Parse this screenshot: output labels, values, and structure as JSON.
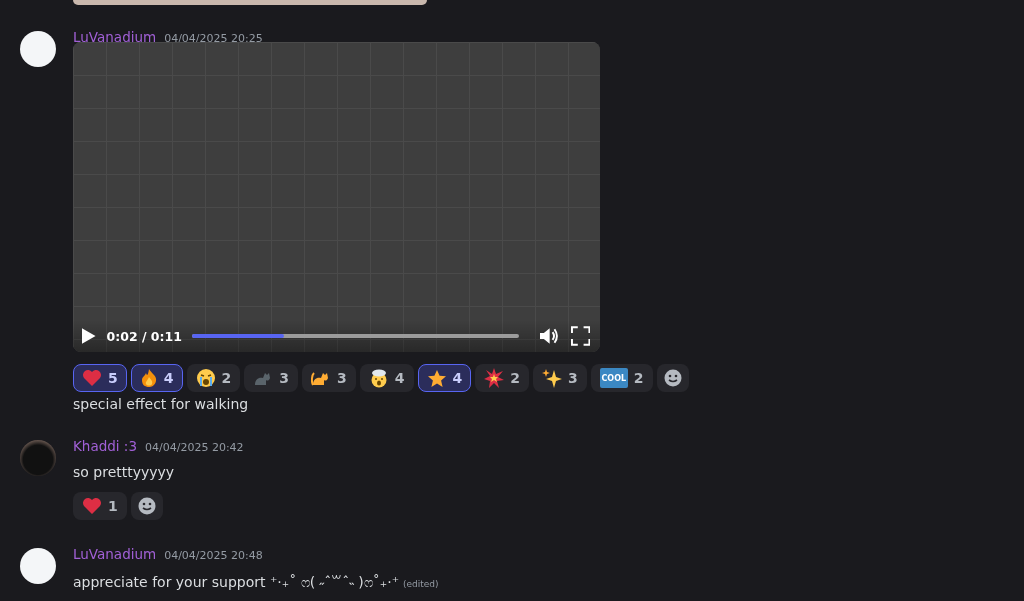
{
  "messages": [
    {
      "author": "LuVanadium",
      "timestamp": "04/04/2025 20:25",
      "avatar": {
        "kind": "sketch"
      },
      "video": {
        "current": "0:02 / 0:11",
        "level": 0.28
      },
      "reactions": [
        {
          "kind": "heart",
          "count": "5",
          "selected": true
        },
        {
          "kind": "fire",
          "count": "4",
          "selected": true
        },
        {
          "kind": "crying",
          "count": "2",
          "selected": false
        },
        {
          "kind": "black-cat",
          "count": "3",
          "selected": false
        },
        {
          "kind": "cat",
          "count": "3",
          "selected": false
        },
        {
          "kind": "mind-blown",
          "count": "4",
          "selected": false
        },
        {
          "kind": "star",
          "count": "4",
          "selected": true
        },
        {
          "kind": "boom",
          "count": "2",
          "selected": false
        },
        {
          "kind": "sparkles",
          "count": "3",
          "selected": false
        },
        {
          "kind": "cool",
          "label": "COOL",
          "count": "2",
          "selected": false
        }
      ],
      "text": "special effect for walking"
    },
    {
      "author": "Khaddi :3",
      "timestamp": "04/04/2025 20:42",
      "avatar": {
        "kind": "cat"
      },
      "text": "so pretttyyyyy",
      "reactions": [
        {
          "kind": "heart",
          "count": "1",
          "selected": false
        }
      ]
    },
    {
      "author": "LuVanadium",
      "timestamp": "04/04/2025 20:48",
      "avatar": {
        "kind": "sketch"
      },
      "text": "appreciate for your support ⁺‧₊˚ ෆ( ˶ˆ꒳ˆ˵ )ෆ˚₊‧⁺",
      "edited": "(edited)"
    }
  ]
}
